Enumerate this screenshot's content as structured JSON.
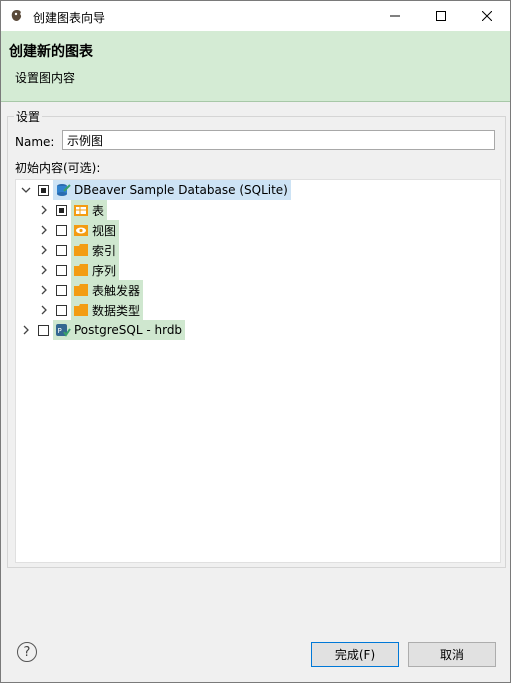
{
  "window": {
    "title": "创建图表向导"
  },
  "banner": {
    "title": "创建新的图表",
    "subtitle": "设置图内容"
  },
  "form": {
    "group_label": "设置",
    "name_label": "Name:",
    "name_value": "示例图",
    "content_label": "初始内容(可选):"
  },
  "tree": {
    "root": {
      "label": "DBeaver Sample Database (SQLite)",
      "state": "partial",
      "expanded": true,
      "icon": "database-icon"
    },
    "children": [
      {
        "label": "表",
        "state": "partial",
        "icon": "table-folder-icon"
      },
      {
        "label": "视图",
        "state": "unchecked",
        "icon": "view-folder-icon"
      },
      {
        "label": "索引",
        "state": "unchecked",
        "icon": "folder-icon"
      },
      {
        "label": "序列",
        "state": "unchecked",
        "icon": "folder-icon"
      },
      {
        "label": "表触发器",
        "state": "unchecked",
        "icon": "folder-icon"
      },
      {
        "label": "数据类型",
        "state": "unchecked",
        "icon": "folder-icon"
      }
    ],
    "second_root": {
      "label": "PostgreSQL - hrdb",
      "state": "unchecked",
      "expanded": false,
      "icon": "postgres-icon"
    }
  },
  "buttons": {
    "finish": "完成(F)",
    "cancel": "取消"
  },
  "colors": {
    "banner": "#d4ebd4",
    "selection": "#cfe7cf",
    "folder": "#f39c12"
  }
}
